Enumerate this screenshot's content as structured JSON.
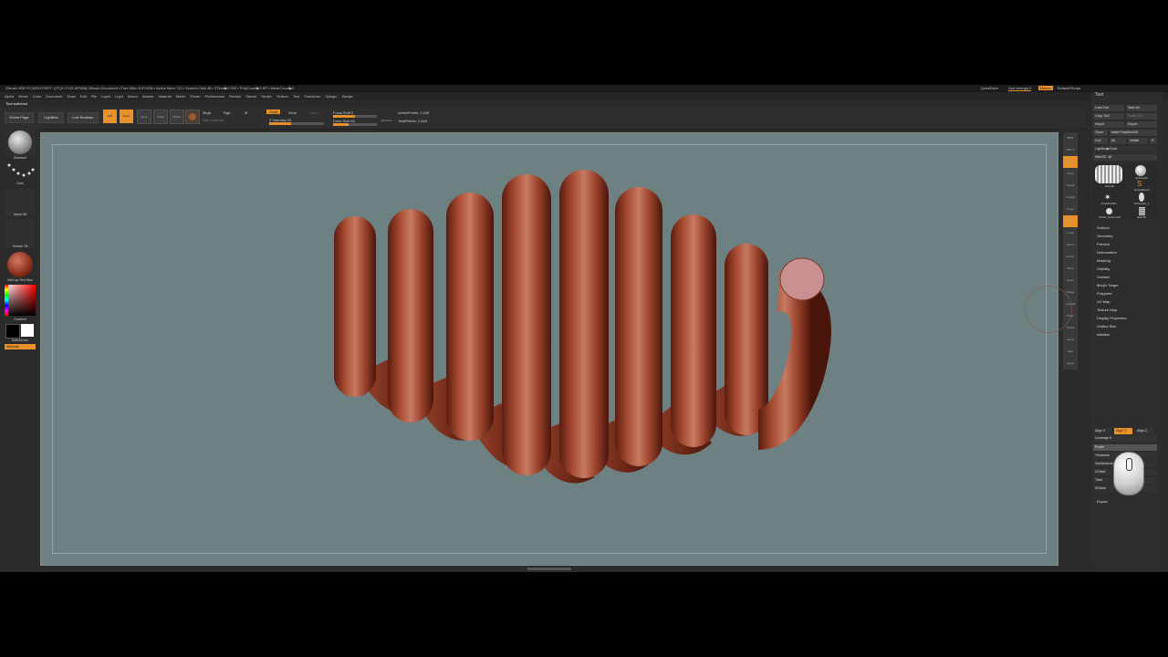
{
  "title_bar": {
    "text": "ZBrush 4R8 P2 [WSH-PWTF-QTQY-CYZI-NPWM]  ZBrush Document  ▪ Free Mem 6.874GB ▪ Active Mem 712 ▪ Scratch Disk 48 ▪ ZTime▶0.009 ▪ PolyCount▶0 KP ▪ MeshCount▶0",
    "quicksave": "QuickSave",
    "see_through": "See-through  0",
    "menus": "Menus",
    "default_zscript": "DefaultZScript"
  },
  "menu_bar": [
    "Alpha",
    "Brush",
    "Color",
    "Document",
    "Draw",
    "Edit",
    "File",
    "Layer",
    "Light",
    "Macro",
    "Marker",
    "Material",
    "Movie",
    "Picker",
    "Preferences",
    "Render",
    "Stencil",
    "Stroke",
    "Texture",
    "Tool",
    "Transform",
    "Zplugin",
    "Zscript"
  ],
  "status": "Tool switched",
  "shelf": {
    "home_page": "Home Page",
    "lightbox": "LightBox",
    "live_boolean": "Live Boolean",
    "edit": "Edit",
    "draw": "Draw",
    "move": "Move",
    "scale": "Scale",
    "rotate": "Rotate",
    "mrgb": "Mrgb",
    "rgb": "Rgb",
    "m": "M",
    "rgb_intensity": "Rgb Intensity",
    "zadd": "Zadd",
    "zsub": "Zsub",
    "zcut": "Zcut",
    "z_intensity": "Z Intensity 25",
    "focal_shift": "Focal Shift 0",
    "draw_size": "Draw Size 64",
    "dynamic": "Dynamic",
    "active_points": "ActivePoints: 2,048",
    "total_points": "TotalPoints: 2,048"
  },
  "left_panel": {
    "brush": "Standard",
    "stroke": "Dots",
    "alpha": "Alpha Off",
    "texture": "Texture Off",
    "material": "MatCap Red Wax",
    "gradient": "Gradient",
    "switch_color": "SwitchColor",
    "alternate": "Alternate"
  },
  "right_strip": [
    "BPR",
    "SPix 3",
    "Scroll",
    "Zoom",
    "Actual",
    "AAHalf",
    "Persp",
    "Floor",
    "Local",
    "Gizmo",
    "Frame",
    "Move",
    "Scale",
    "Rotate",
    "Line Fill",
    "PolyF",
    "Transp",
    "Ghost",
    "Solo",
    "Xpose"
  ],
  "tool_panel": {
    "header": "Tool",
    "load_tool": "Load Tool",
    "save_as": "Save As",
    "copy_tool": "Copy Tool",
    "paste_tool": "Paste Tool",
    "import": "Import",
    "export": "Export",
    "clone": "Clone",
    "make_polymesh": "Make PolyMesh3D",
    "goz": "GoZ",
    "all": "All",
    "visible": "Visible",
    "r": "R",
    "lightbox_tools": "Lightbox▶Tools",
    "current_tool": "Helix3D. 48",
    "thumbs": [
      "Helix3D",
      "Sphere3D",
      "SimpleBrush",
      "PolyMesh3D",
      "Sphere3D_1",
      "PM3D_Sphere3D",
      "Helix3D"
    ],
    "sections": [
      "Subtool",
      "Geometry",
      "Preview",
      "Deformation",
      "Masking",
      "Visibility",
      "Contact",
      "Morph Target",
      "Polypaint",
      "UV Map",
      "Texture Map",
      "Display Properties",
      "Unified Skin",
      "Initialize"
    ],
    "align_x": "Align X",
    "align_y": "Align Y",
    "align_z": "Align Z",
    "coverage": "Coverage 8",
    "profile": "Profile",
    "thickness": "Thickness",
    "sections_lbl": "SubSections",
    "zoffset": "ZOffset",
    "twist": "Twist",
    "subdivide": "SDivide",
    "export_btn": "Export"
  },
  "colors": {
    "accent": "#e8902a",
    "viewport_bg": "#6e8182",
    "model": "#8a3a24",
    "model_highlight": "#c77a62",
    "cap": "#c99091"
  }
}
